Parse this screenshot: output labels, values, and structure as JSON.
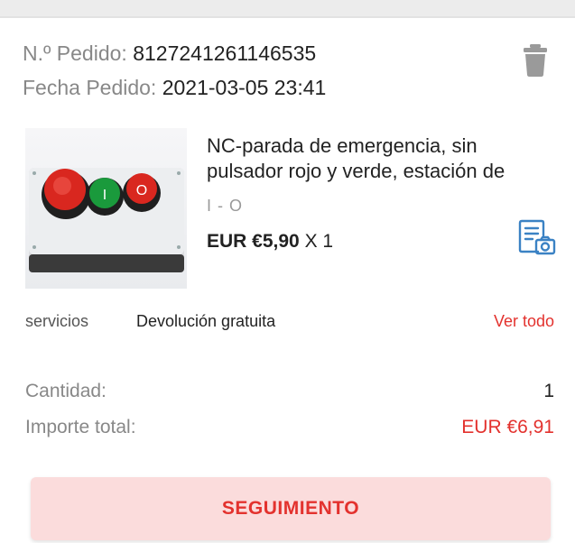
{
  "order": {
    "number_label": "N.º Pedido:",
    "number_value": "8127241261146535",
    "date_label": "Fecha Pedido:",
    "date_value": "2021-03-05 23:41"
  },
  "product": {
    "title_line1": "NC-parada de emergencia, sin",
    "title_line2": "pulsador rojo y verde, estación de",
    "variant": "I - O",
    "price": "EUR €5,90",
    "quantity_suffix": " X 1",
    "image_button_labels": [
      "I",
      "O"
    ]
  },
  "services": {
    "label": "servicios",
    "value": "Devolución gratuita",
    "link": "Ver todo"
  },
  "summary": {
    "quantity_label": "Cantidad:",
    "quantity_value": "1",
    "total_label": "Importe total:",
    "total_value": "EUR €6,91"
  },
  "actions": {
    "tracking_label": "SEGUIMIENTO"
  },
  "colors": {
    "accent": "#e3322e",
    "button_bg": "#fbdcdc",
    "icon_blue": "#3b82c4",
    "muted": "#888888"
  },
  "icons": [
    "trash-icon",
    "receipt-camera-icon"
  ]
}
